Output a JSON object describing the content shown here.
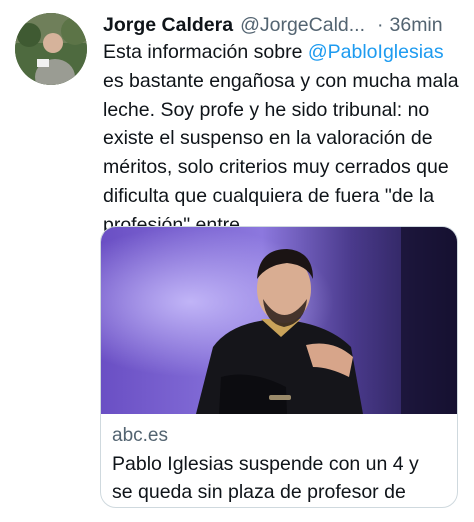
{
  "tweet": {
    "author_name": "Jorge Caldera",
    "author_handle": "@JorgeCald...",
    "separator": "·",
    "time": "36min",
    "text_lines": [
      "Esta información sobre ",
      "@PabloIglesias",
      "es bastante engañosa y con mucha mala",
      "leche. Soy profe y he sido tribunal: no",
      "existe el suspenso en la valoración de",
      "méritos, solo criterios muy cerrados que",
      "dificulta que cualquiera de fuera \"de la",
      "profesión\" entre."
    ]
  },
  "link_card": {
    "domain": "abc.es",
    "title_line1": "Pablo Iglesias suspende con un 4 y",
    "title_line2": "se queda sin plaza de profesor de Pe..."
  },
  "colors": {
    "mention": "#1d9bf0",
    "secondary_text": "#536471",
    "card_border": "#cfd9de"
  }
}
